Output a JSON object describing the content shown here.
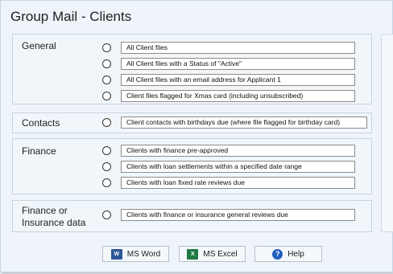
{
  "window": {
    "title": "Group Mail - Clients"
  },
  "sections": {
    "general": {
      "label": "General",
      "options": [
        "All Client files",
        "All Client files with a Status of \"Active\"",
        "All Client files with an email address for Applicant 1",
        "Client files flagged for Xmas card (including unsubscribed)"
      ]
    },
    "contacts": {
      "label": "Contacts",
      "options": [
        "Client contacts with birthdays due (where file flagged for birthday card)"
      ]
    },
    "finance": {
      "label": "Finance",
      "options": [
        "Clients with finance pre-approved",
        "Clients with loan settlements within a specified date range",
        "Clients with loan fixed rate reviews due"
      ]
    },
    "finance_insurance": {
      "label_line1": "Finance or",
      "label_line2": "Insurance data",
      "options": [
        "Clients with finance or insurance general reviews due"
      ]
    }
  },
  "buttons": {
    "word": {
      "label": "MS Word",
      "icon": "word-icon"
    },
    "excel": {
      "label": "MS Excel",
      "icon": "excel-icon"
    },
    "help": {
      "label": "Help",
      "icon": "help-icon"
    }
  },
  "colors": {
    "background": "#eef4fa",
    "word": "#2b5797",
    "excel": "#1f7a43",
    "help": "#1f5fbf"
  }
}
